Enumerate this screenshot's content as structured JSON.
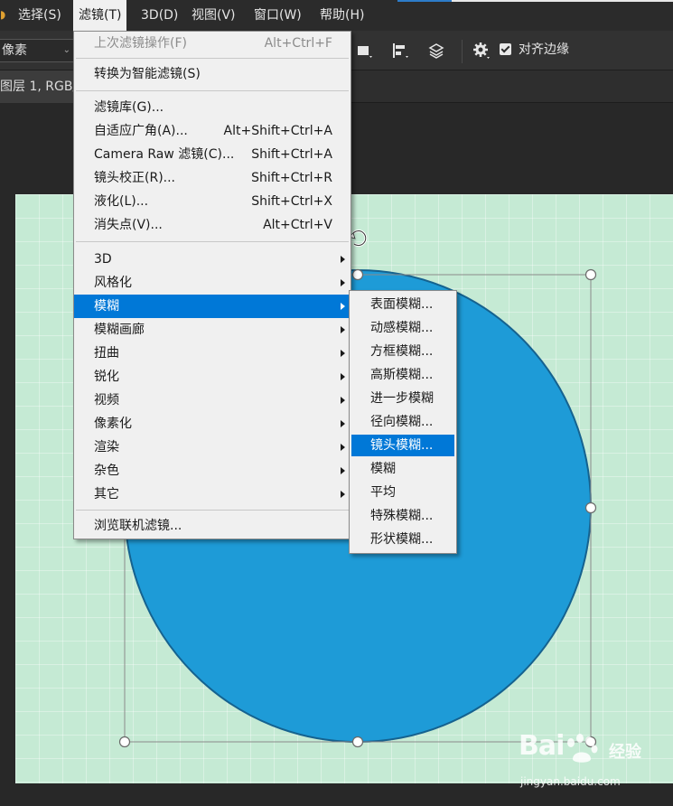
{
  "menubar": {
    "items": [
      {
        "label": "选择(S)"
      },
      {
        "label": "滤镜(T)"
      },
      {
        "label": "3D(D)"
      },
      {
        "label": "视图(V)"
      },
      {
        "label": "窗口(W)"
      },
      {
        "label": "帮助(H)"
      }
    ]
  },
  "options": {
    "unit_value": "像素",
    "snap_label": "对齐边缘"
  },
  "document": {
    "tab_title": "图层 1, RGB/"
  },
  "filter_menu": {
    "last_filter": {
      "label": "上次滤镜操作(F)",
      "shortcut": "Alt+Ctrl+F"
    },
    "smart_filters": {
      "label": "转换为智能滤镜(S)"
    },
    "group_filters": [
      {
        "label": "滤镜库(G)...",
        "shortcut": ""
      },
      {
        "label": "自适应广角(A)...",
        "shortcut": "Alt+Shift+Ctrl+A"
      },
      {
        "label": "Camera Raw 滤镜(C)...",
        "shortcut": "Shift+Ctrl+A"
      },
      {
        "label": "镜头校正(R)...",
        "shortcut": "Shift+Ctrl+R"
      },
      {
        "label": "液化(L)...",
        "shortcut": "Shift+Ctrl+X"
      },
      {
        "label": "消失点(V)...",
        "shortcut": "Alt+Ctrl+V"
      }
    ],
    "submenus": [
      {
        "label": "3D"
      },
      {
        "label": "风格化"
      },
      {
        "label": "模糊"
      },
      {
        "label": "模糊画廊"
      },
      {
        "label": "扭曲"
      },
      {
        "label": "锐化"
      },
      {
        "label": "视频"
      },
      {
        "label": "像素化"
      },
      {
        "label": "渲染"
      },
      {
        "label": "杂色"
      },
      {
        "label": "其它"
      }
    ],
    "browse": {
      "label": "浏览联机滤镜..."
    }
  },
  "blur_submenu": {
    "items": [
      {
        "label": "表面模糊..."
      },
      {
        "label": "动感模糊..."
      },
      {
        "label": "方框模糊..."
      },
      {
        "label": "高斯模糊..."
      },
      {
        "label": "进一步模糊"
      },
      {
        "label": "径向模糊..."
      },
      {
        "label": "镜头模糊..."
      },
      {
        "label": "模糊"
      },
      {
        "label": "平均"
      },
      {
        "label": "特殊模糊..."
      },
      {
        "label": "形状模糊..."
      }
    ]
  },
  "watermark": {
    "brand": "Bai",
    "brand_suffix": "经验",
    "url": "jingyan.baidu.com"
  },
  "colors": {
    "accent": "#0078d7",
    "circle_fill": "#1e9bd7",
    "canvas_bg": "#c5ead4"
  }
}
